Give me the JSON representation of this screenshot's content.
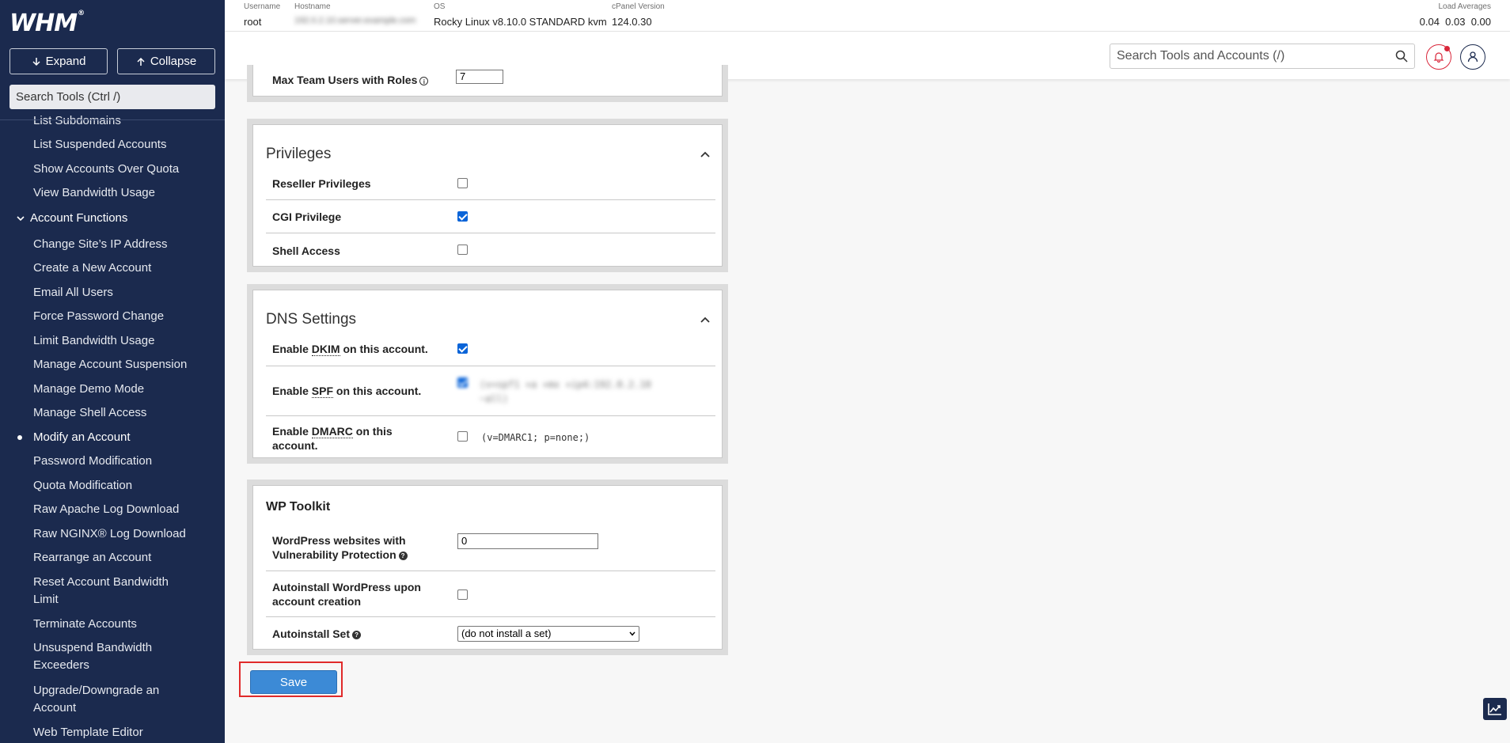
{
  "sidebar": {
    "logo": "WHM",
    "logo_mark": "®",
    "expand_label": "Expand",
    "collapse_label": "Collapse",
    "search_placeholder": "Search Tools (Ctrl /)",
    "items_top": [
      "List Subdomains",
      "List Suspended Accounts",
      "Show Accounts Over Quota",
      "View Bandwidth Usage"
    ],
    "group_label": "Account Functions",
    "items": [
      "Change Site’s IP Address",
      "Create a New Account",
      "Email All Users",
      "Force Password Change",
      "Limit Bandwidth Usage",
      "Manage Account Suspension",
      "Manage Demo Mode",
      "Manage Shell Access",
      "Modify an Account",
      "Password Modification",
      "Quota Modification",
      "Raw Apache Log Download",
      "Raw NGINX® Log Download",
      "Rearrange an Account",
      "Reset Account Bandwidth Limit",
      "Terminate Accounts",
      "Unsuspend Bandwidth Exceeders",
      "Upgrade/Downgrade an Account",
      "Web Template Editor"
    ],
    "active_item": "Modify an Account"
  },
  "topbar": {
    "username_label": "Username",
    "username": "root",
    "hostname_label": "Hostname",
    "hostname": "192.0.2.10.server.example.com",
    "os_label": "OS",
    "os": "Rocky Linux v8.10.0 STANDARD kvm",
    "cpanel_label": "cPanel Version",
    "cpanel_version": "124.0.30",
    "load_label": "Load Averages",
    "load_values": "0.04  0.03  0.00"
  },
  "header": {
    "search_placeholder": "Search Tools and Accounts (/)"
  },
  "top_panel": {
    "label": "Max Team Users with Roles",
    "value": "7"
  },
  "privileges": {
    "title": "Privileges",
    "rows": [
      {
        "label": "Reseller Privileges",
        "checked": false
      },
      {
        "label": "CGI Privilege",
        "checked": true
      },
      {
        "label": "Shell Access",
        "checked": false
      }
    ]
  },
  "dns": {
    "title": "DNS Settings",
    "dkim_pre": "Enable ",
    "dkim_abbr": "DKIM",
    "dkim_post": " on this account.",
    "spf_pre": "Enable ",
    "spf_abbr": "SPF",
    "spf_post": " on this account.",
    "spf_record": "(v=spf1 +a +mx +ip4:192.0.2.10 ~all)",
    "dmarc_pre": "Enable ",
    "dmarc_abbr": "DMARC",
    "dmarc_post": " on this account.",
    "dmarc_record": "(v=DMARC1; p=none;)"
  },
  "wp": {
    "title": "WP Toolkit",
    "vuln_label": "WordPress websites with Vulnerability Protection",
    "vuln_value": "0",
    "autoinstall_label": "Autoinstall WordPress upon account creation",
    "set_label": "Autoinstall Set",
    "set_value": "(do not install a set)"
  },
  "save_label": "Save",
  "colors": {
    "sidebar_bg": "#1b2a4e",
    "accent": "#3c8ad6",
    "highlight": "#e02a2a"
  }
}
